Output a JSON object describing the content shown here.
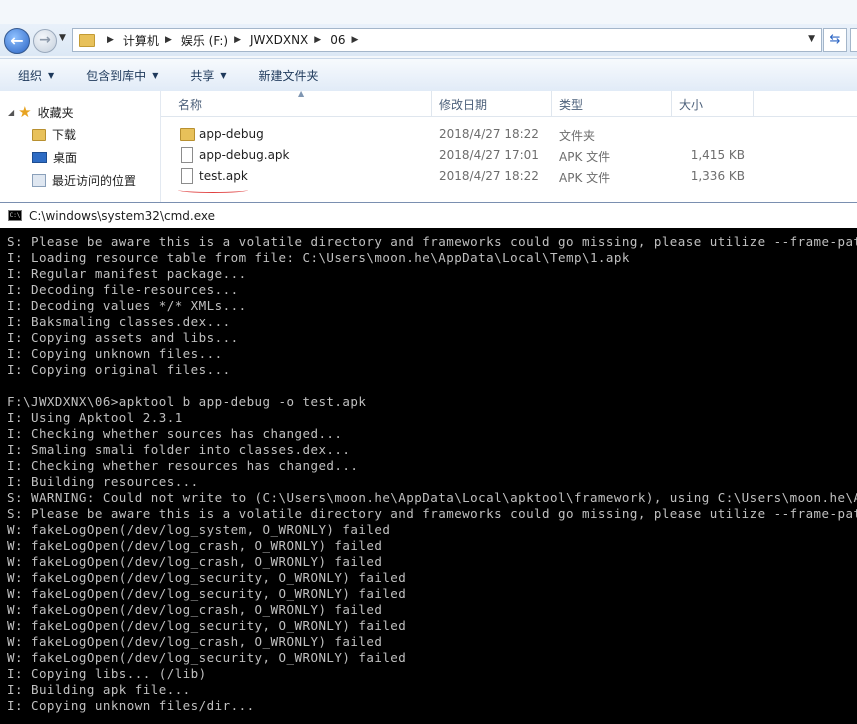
{
  "explorer": {
    "breadcrumbs": [
      "计算机",
      "娱乐 (F:)",
      "JWXDXNX",
      "06"
    ],
    "toolbar": [
      {
        "label": "组织",
        "dropdown": true
      },
      {
        "label": "包含到库中",
        "dropdown": true
      },
      {
        "label": "共享",
        "dropdown": true
      },
      {
        "label": "新建文件夹",
        "dropdown": false
      }
    ],
    "nav": {
      "favorites": "收藏夹",
      "items": [
        "下载",
        "桌面",
        "最近访问的位置"
      ]
    },
    "columns": [
      "名称",
      "修改日期",
      "类型",
      "大小"
    ],
    "files": [
      {
        "name": "app-debug",
        "date": "2018/4/27 18:22",
        "type": "文件夹",
        "size": "",
        "icon": "folder-icon"
      },
      {
        "name": "app-debug.apk",
        "date": "2018/4/27 17:01",
        "type": "APK 文件",
        "size": "1,415 KB",
        "icon": "file-icon"
      },
      {
        "name": "test.apk",
        "date": "2018/4/27 18:22",
        "type": "APK 文件",
        "size": "1,336 KB",
        "icon": "file-icon"
      }
    ]
  },
  "cmd": {
    "title": "C:\\windows\\system32\\cmd.exe",
    "lines": [
      "S: Please be aware this is a volatile directory and frameworks could go missing, please utilize --frame-path if the default storage directory is unavailable",
      "I: Loading resource table from file: C:\\Users\\moon.he\\AppData\\Local\\Temp\\1.apk",
      "I: Regular manifest package...",
      "I: Decoding file-resources...",
      "I: Decoding values */* XMLs...",
      "I: Baksmaling classes.dex...",
      "I: Copying assets and libs...",
      "I: Copying unknown files...",
      "I: Copying original files...",
      "",
      "F:\\JWXDXNX\\06>apktool b app-debug -o test.apk",
      "I: Using Apktool 2.3.1",
      "I: Checking whether sources has changed...",
      "I: Smaling smali folder into classes.dex...",
      "I: Checking whether resources has changed...",
      "I: Building resources...",
      "S: WARNING: Could not write to (C:\\Users\\moon.he\\AppData\\Local\\apktool\\framework), using C:\\Users\\moon.he\\AppData\\Local\\Temp instead...",
      "S: Please be aware this is a volatile directory and frameworks could go missing, please utilize --frame-path if the default storage directory is unavailable",
      "W: fakeLogOpen(/dev/log_system, O_WRONLY) failed",
      "W: fakeLogOpen(/dev/log_crash, O_WRONLY) failed",
      "W: fakeLogOpen(/dev/log_crash, O_WRONLY) failed",
      "W: fakeLogOpen(/dev/log_security, O_WRONLY) failed",
      "W: fakeLogOpen(/dev/log_security, O_WRONLY) failed",
      "W: fakeLogOpen(/dev/log_crash, O_WRONLY) failed",
      "W: fakeLogOpen(/dev/log_security, O_WRONLY) failed",
      "W: fakeLogOpen(/dev/log_crash, O_WRONLY) failed",
      "W: fakeLogOpen(/dev/log_security, O_WRONLY) failed",
      "I: Copying libs... (/lib)",
      "I: Building apk file...",
      "I: Copying unknown files/dir..."
    ]
  },
  "colors": {
    "cmd_bg": "#000000",
    "cmd_text": "#c0c0c0",
    "annotation_underline": "#e04040"
  }
}
